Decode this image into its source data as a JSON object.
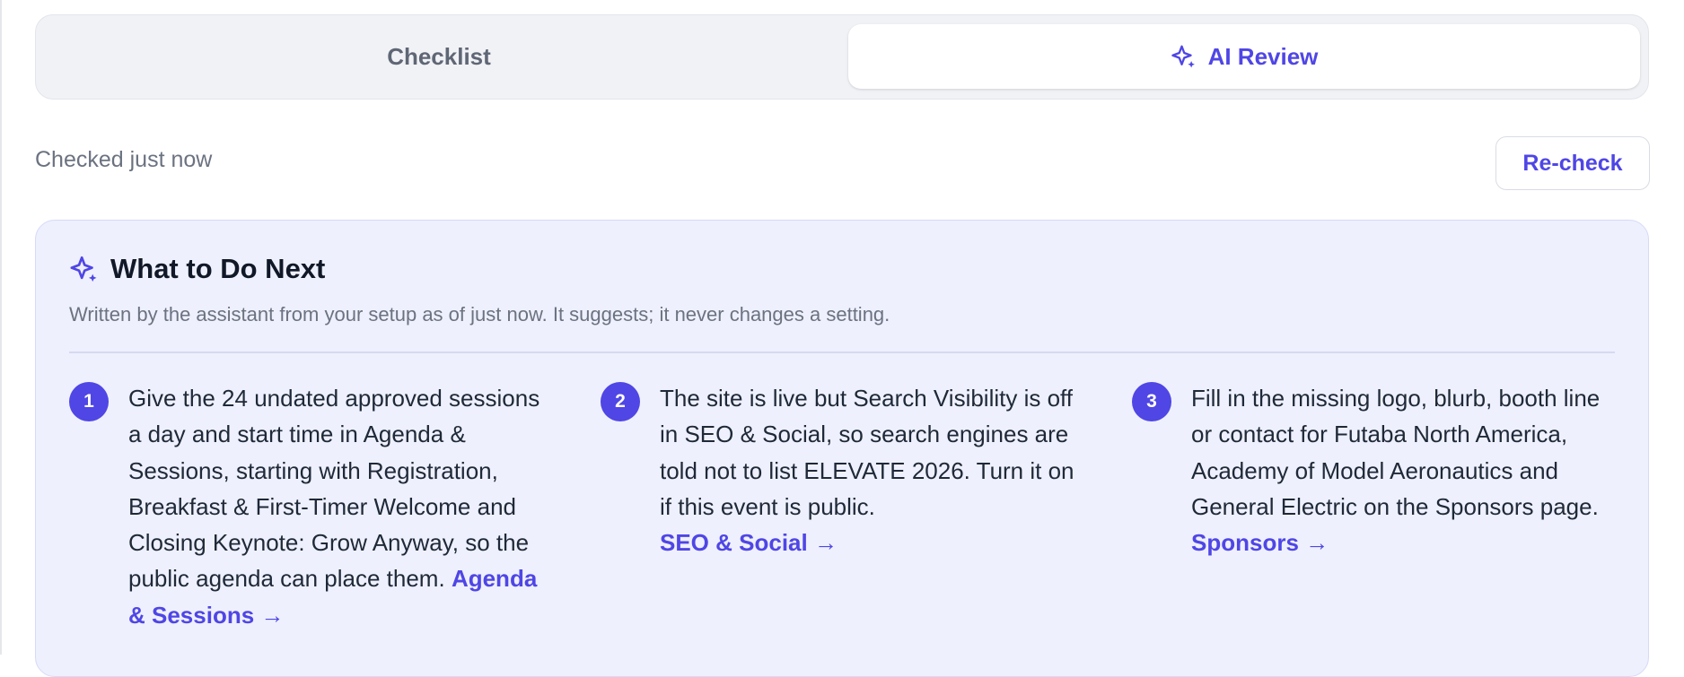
{
  "tabs": {
    "checklist_label": "Checklist",
    "ai_review_label": "AI Review",
    "active": "AI Review"
  },
  "status": {
    "checked_text": "Checked just now",
    "recheck_label": "Re-check"
  },
  "card": {
    "title": "What to Do Next",
    "subtitle": "Written by the assistant from your setup as of just now. It suggests; it never changes a setting.",
    "items": [
      {
        "number": "1",
        "text": "Give the 24 undated approved sessions a day and start time in Agenda & Sessions, starting with Registration, Breakfast & First-Timer Welcome and Closing Keynote: Grow Anyway, so the public agenda can place them.",
        "link_label": "Agenda & Sessions →"
      },
      {
        "number": "2",
        "text": "The site is live but Search Visibility is off in SEO & Social, so search engines are told not to list ELEVATE 2026. Turn it on if this event is public.",
        "link_label": "SEO & Social →"
      },
      {
        "number": "3",
        "text": "Fill in the missing logo, blurb, booth line or contact for Futaba North America, Academy of Model Aeronautics and General Electric on the Sponsors page.",
        "link_label": "Sponsors →"
      }
    ]
  },
  "icons": {
    "tab_ai": "sparkle-icon",
    "card_header": "sparkle-icon"
  },
  "colors": {
    "accent": "#4f46e5",
    "card_background": "#eef0fe",
    "tab_track": "#f1f2f6",
    "muted_text": "#6b7280"
  }
}
